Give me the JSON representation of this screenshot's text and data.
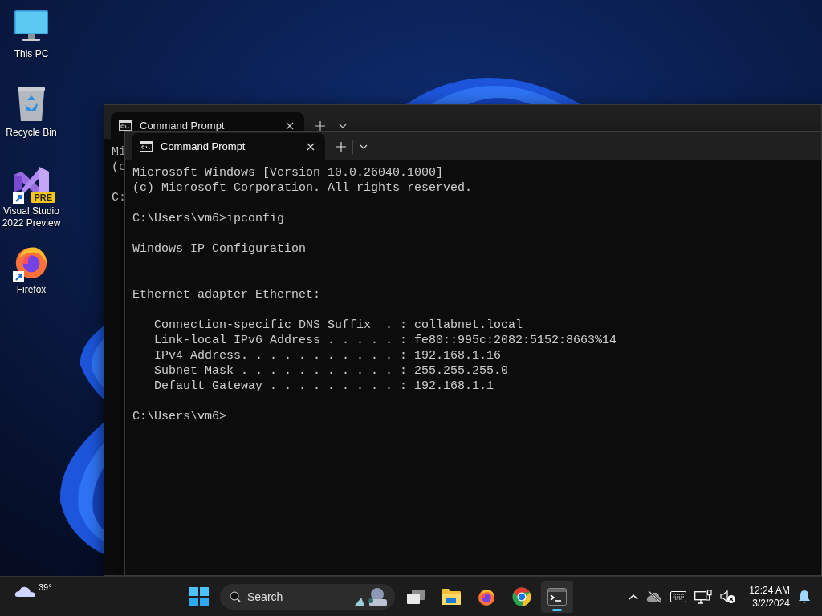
{
  "desktop": {
    "icons": [
      {
        "kind": "computer",
        "label": "This PC",
        "shortcut": false
      },
      {
        "kind": "recycle-bin",
        "label": "Recycle Bin",
        "shortcut": false
      },
      {
        "kind": "visual-studio",
        "label": "Visual Studio 2022 Preview",
        "badge": "PRE",
        "shortcut": true
      },
      {
        "kind": "firefox",
        "label": "Firefox",
        "shortcut": true
      }
    ]
  },
  "windows": [
    {
      "tabs": [
        {
          "title": "Command Prompt",
          "selected": true
        }
      ],
      "lines": [
        {
          "kind": "text",
          "text": "Mi"
        },
        {
          "kind": "text",
          "text": "(c"
        },
        {
          "kind": "blank"
        },
        {
          "kind": "text",
          "text": "C:"
        }
      ]
    },
    {
      "tabs": [
        {
          "title": "Command Prompt",
          "selected": true
        }
      ],
      "lines": [
        {
          "kind": "text",
          "text": "Microsoft Windows [Version 10.0.26040.1000]"
        },
        {
          "kind": "text",
          "text": "(c) Microsoft Corporation. All rights reserved."
        },
        {
          "kind": "blank"
        },
        {
          "kind": "text",
          "text": "C:\\Users\\vm6>ipconfig"
        },
        {
          "kind": "blank"
        },
        {
          "kind": "text",
          "text": "Windows IP Configuration"
        },
        {
          "kind": "blank"
        },
        {
          "kind": "blank"
        },
        {
          "kind": "text",
          "text": "Ethernet adapter Ethernet:"
        },
        {
          "kind": "blank"
        },
        {
          "kind": "text",
          "text": "   Connection-specific DNS Suffix  . : collabnet.local"
        },
        {
          "kind": "text",
          "text": "   Link-local IPv6 Address . . . . . : fe80::995c:2082:5152:8663%14"
        },
        {
          "kind": "text",
          "text": "   IPv4 Address. . . . . . . . . . . : 192.168.1.16"
        },
        {
          "kind": "text",
          "text": "   Subnet Mask . . . . . . . . . . . : 255.255.255.0"
        },
        {
          "kind": "text",
          "text": "   Default Gateway . . . . . . . . . : 192.168.1.1"
        },
        {
          "kind": "blank"
        },
        {
          "kind": "text",
          "text": "C:\\Users\\vm6>"
        }
      ]
    }
  ],
  "taskbar": {
    "weather": {
      "temperature": "39°"
    },
    "search": {
      "placeholder": "Search"
    },
    "apps": [
      {
        "kind": "task-view",
        "selected": false
      },
      {
        "kind": "folder",
        "selected": false
      },
      {
        "kind": "firefox",
        "selected": false
      },
      {
        "kind": "chrome",
        "selected": false
      },
      {
        "kind": "terminal",
        "selected": true
      }
    ],
    "tray": {
      "time": "12:24 AM",
      "date": "3/2/2024"
    }
  }
}
